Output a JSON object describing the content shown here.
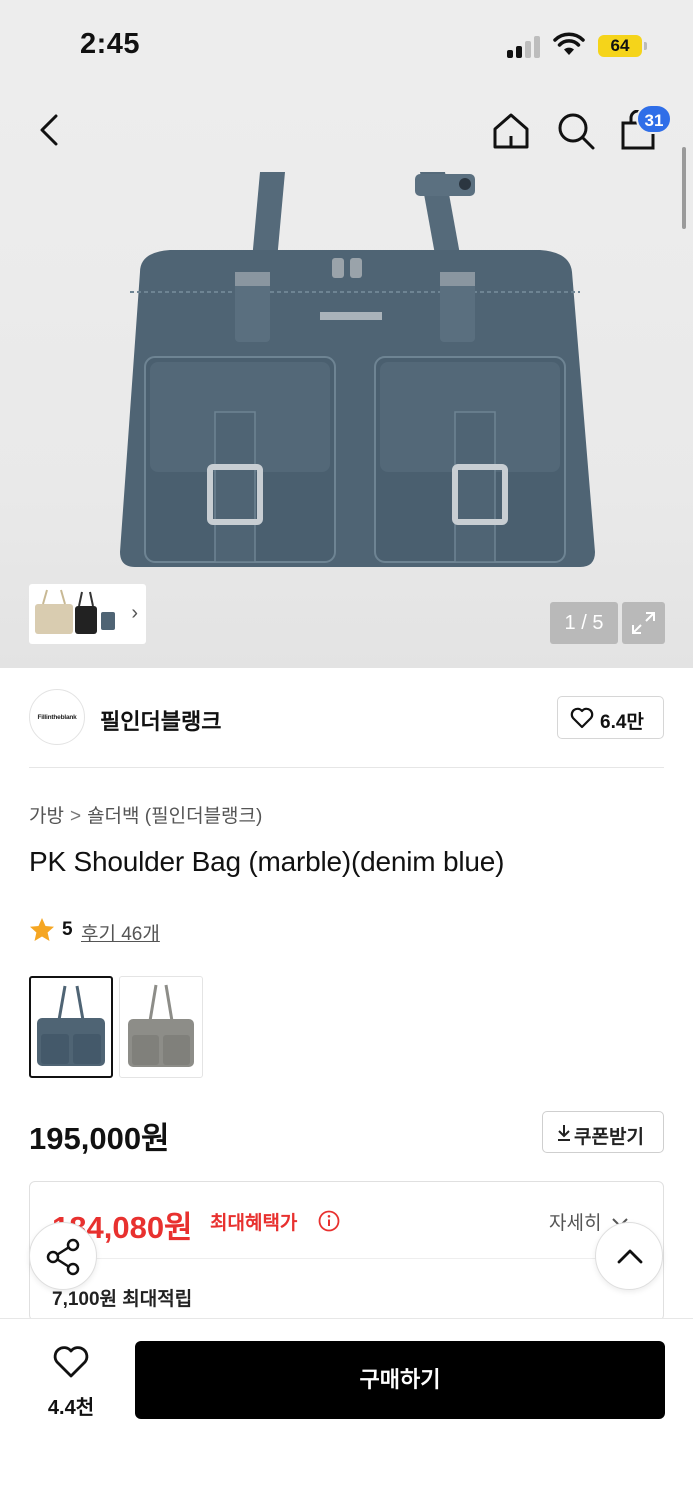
{
  "status_bar": {
    "time": "2:45",
    "battery": "64"
  },
  "header": {
    "cart_count": "31"
  },
  "gallery": {
    "counter": "1 / 5"
  },
  "brand": {
    "logo_text": "Fillintheblank",
    "name": "필인더블랭크",
    "likes": "6.4만"
  },
  "product": {
    "breadcrumb": [
      "가방",
      "숄더백 (필인더블랭크)"
    ],
    "breadcrumb_sep": ">",
    "title": "PK Shoulder Bag (marble)(denim blue)",
    "rating": "5",
    "reviews": "후기 46개",
    "options": [
      {
        "name": "denim blue",
        "color": "#4f6474"
      },
      {
        "name": "grey",
        "color": "#8d8d88"
      }
    ],
    "price": "195,000원",
    "coupon_label": "쿠폰받기"
  },
  "benefit": {
    "max_price": "184,080원",
    "max_label": "최대혜택가",
    "detail_label": "자세히",
    "points": "7,100원 최대적립"
  },
  "bottom_bar": {
    "wish_count": "4.4천",
    "buy_label": "구매하기"
  },
  "colors": {
    "accent_red": "#e8312f",
    "badge_blue": "#2f6ee8",
    "star": "#f5a623",
    "buy_bg": "#000000"
  }
}
